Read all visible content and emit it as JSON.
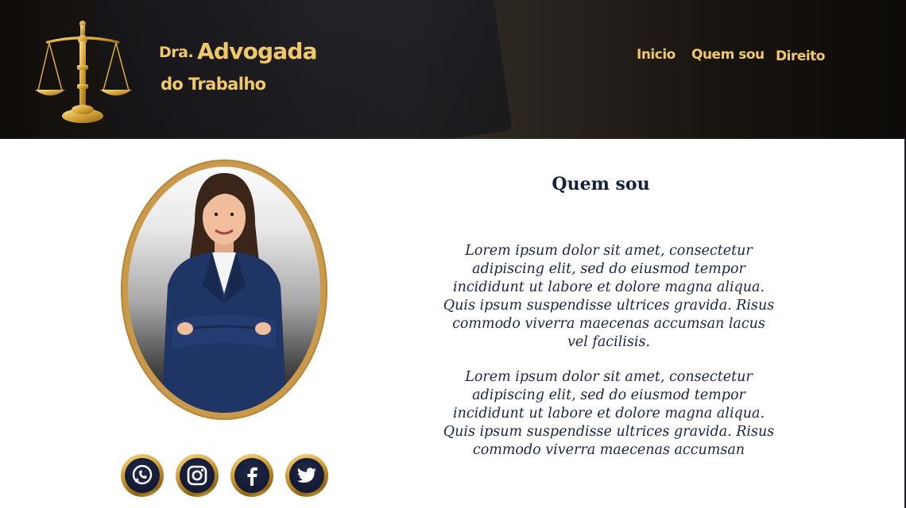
{
  "header": {
    "brand": {
      "prefix": "Dra.",
      "name": "Advogada",
      "subtitle": "do Trabalho"
    },
    "nav": [
      {
        "label": "Inicio"
      },
      {
        "label": "Quem sou"
      },
      {
        "label": "Direito"
      }
    ]
  },
  "about": {
    "title": "Quem sou",
    "paragraphs": [
      "Lorem ipsum dolor sit amet, consectetur adipiscing elit, sed do eiusmod tempor incididunt ut labore et dolore magna aliqua. Quis ipsum suspendisse ultrices gravida. Risus commodo viverra maecenas accumsan lacus vel facilisis.",
      "Lorem ipsum dolor sit amet, consectetur adipiscing elit, sed do eiusmod tempor incididunt ut labore et dolore magna aliqua. Quis ipsum suspendisse ultrices gravida. Risus commodo viverra maecenas accumsan"
    ]
  },
  "social": [
    {
      "icon": "whatsapp-icon"
    },
    {
      "icon": "instagram-icon"
    },
    {
      "icon": "facebook-icon"
    },
    {
      "icon": "twitter-icon"
    }
  ],
  "colors": {
    "gold": "#f0c86a",
    "frame_gold": "#c99a4c",
    "navy": "#14213d",
    "header_dark": "#1c1814"
  }
}
